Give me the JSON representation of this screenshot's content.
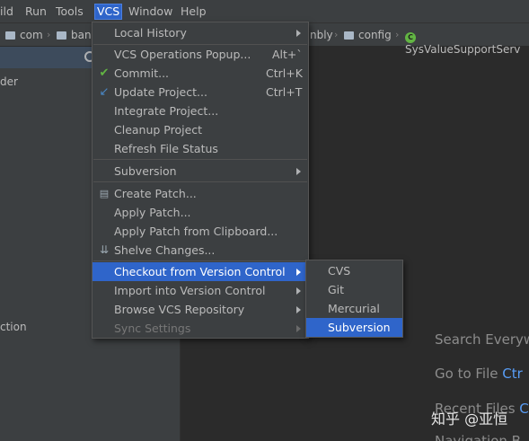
{
  "menubar": {
    "items": [
      {
        "label": "ild"
      },
      {
        "label": "Run"
      },
      {
        "label": "Tools"
      },
      {
        "label": "VCS"
      },
      {
        "label": "Window"
      },
      {
        "label": "Help"
      }
    ]
  },
  "breadcrumbs": {
    "items": [
      {
        "label": "com"
      },
      {
        "label": "ban"
      },
      {
        "label": "nbly"
      },
      {
        "label": "config"
      },
      {
        "label": "SysValueSupportServ"
      }
    ],
    "class_icon_letter": "C"
  },
  "left_panel": {
    "lines": [
      {
        "text": "der"
      },
      {
        "text": "ction"
      }
    ]
  },
  "editor": {
    "hints": [
      {
        "text": "Search Everyw",
        "key": ""
      },
      {
        "text": "Go to File ",
        "key": "Ctr"
      },
      {
        "text": "Recent Files ",
        "key": "C"
      },
      {
        "text": "Navigation B",
        "key": ""
      }
    ]
  },
  "vcs_menu": {
    "items": [
      {
        "label": "Local History",
        "shortcut": "",
        "submenu": true,
        "icon": ""
      },
      {
        "label": "VCS Operations Popup...",
        "shortcut": "Alt+`",
        "submenu": false,
        "icon": ""
      },
      {
        "label": "Commit...",
        "shortcut": "Ctrl+K",
        "submenu": false,
        "icon": "✔"
      },
      {
        "label": "Update Project...",
        "shortcut": "Ctrl+T",
        "submenu": false,
        "icon": "↙"
      },
      {
        "label": "Integrate Project...",
        "shortcut": "",
        "submenu": false,
        "icon": ""
      },
      {
        "label": "Cleanup Project",
        "shortcut": "",
        "submenu": false,
        "icon": ""
      },
      {
        "label": "Refresh File Status",
        "shortcut": "",
        "submenu": false,
        "icon": ""
      },
      {
        "label": "Subversion",
        "shortcut": "",
        "submenu": true,
        "icon": ""
      },
      {
        "label": "Create Patch...",
        "shortcut": "",
        "submenu": false,
        "icon": "▤"
      },
      {
        "label": "Apply Patch...",
        "shortcut": "",
        "submenu": false,
        "icon": ""
      },
      {
        "label": "Apply Patch from Clipboard...",
        "shortcut": "",
        "submenu": false,
        "icon": ""
      },
      {
        "label": "Shelve Changes...",
        "shortcut": "",
        "submenu": false,
        "icon": "⇊"
      },
      {
        "label": "Checkout from Version Control",
        "shortcut": "",
        "submenu": true,
        "icon": ""
      },
      {
        "label": "Import into Version Control",
        "shortcut": "",
        "submenu": true,
        "icon": ""
      },
      {
        "label": "Browse VCS Repository",
        "shortcut": "",
        "submenu": true,
        "icon": ""
      },
      {
        "label": "Sync Settings",
        "shortcut": "",
        "submenu": true,
        "icon": ""
      }
    ]
  },
  "checkout_submenu": {
    "items": [
      {
        "label": "CVS"
      },
      {
        "label": "Git"
      },
      {
        "label": "Mercurial"
      },
      {
        "label": "Subversion"
      }
    ]
  },
  "watermark": {
    "text": "知乎 @亚恒"
  },
  "colors": {
    "selection": "#2f65ca",
    "menu_bg": "#3c3f41",
    "editor_bg": "#2b2b2b",
    "commit_icon": "#62b543",
    "update_icon": "#4a88c7"
  },
  "icons": {
    "commit": "check-icon",
    "update": "update-arrow-icon",
    "create_patch": "patch-file-icon",
    "shelve": "shelve-icon",
    "submenu": "chevron-right-icon",
    "gear": "gear-icon",
    "folder": "folder-icon",
    "class": "class-icon"
  }
}
